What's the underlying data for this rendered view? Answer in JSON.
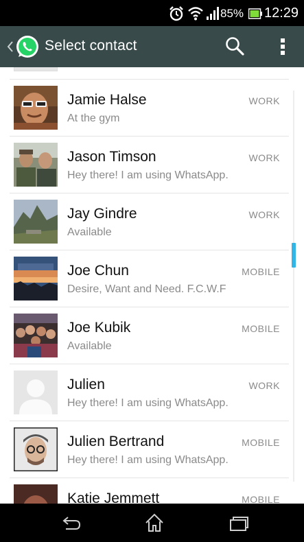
{
  "status_bar": {
    "battery_percent": "85%",
    "time": "12:29",
    "icons": [
      "alarm-icon",
      "wifi-icon",
      "signal-icon",
      "battery-icon"
    ]
  },
  "action_bar": {
    "title": "Select contact",
    "icons": [
      "up-caret-icon",
      "whatsapp-logo",
      "search-icon",
      "overflow-menu-icon"
    ]
  },
  "contacts": [
    {
      "name": "Jamie Halse",
      "status": "At the gym",
      "type": "WORK"
    },
    {
      "name": "Jason Timson",
      "status": "Hey there! I am using WhatsApp.",
      "type": "WORK"
    },
    {
      "name": "Jay Gindre",
      "status": "Available",
      "type": "WORK"
    },
    {
      "name": "Joe Chun",
      "status": "Desire, Want and Need. F.C.W.F",
      "type": "MOBILE"
    },
    {
      "name": "Joe Kubik",
      "status": "Available",
      "type": "MOBILE"
    },
    {
      "name": "Julien",
      "status": "Hey there! I am using WhatsApp.",
      "type": "WORK"
    },
    {
      "name": "Julien Bertrand",
      "status": "Hey there! I am using WhatsApp.",
      "type": "MOBILE"
    },
    {
      "name": "Katie Jemmett",
      "status": "",
      "type": "MOBILE"
    }
  ],
  "nav_bar": {
    "icons": [
      "back-icon",
      "home-icon",
      "recent-apps-icon"
    ]
  },
  "colors": {
    "action_bar": "#394a4a",
    "whatsapp_green": "#25d366",
    "scroll_accent": "#33b5e5"
  }
}
